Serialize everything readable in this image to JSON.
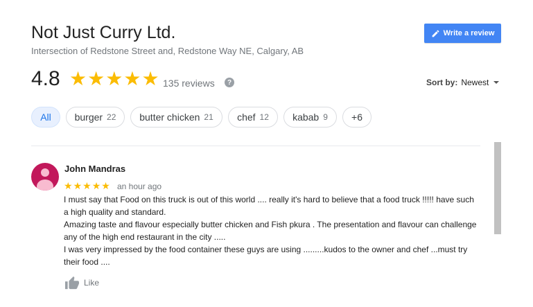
{
  "business": {
    "name": "Not Just Curry Ltd.",
    "address": "Intersection of Redstone Street and, Redstone Way NE, Calgary, AB"
  },
  "write_review": {
    "label": "Write a review",
    "icon": "pencil-icon"
  },
  "summary": {
    "rating": "4.8",
    "stars": 5,
    "reviews_label": "135 reviews"
  },
  "sort": {
    "label": "Sort by:",
    "value": "Newest"
  },
  "filters": [
    {
      "label": "All",
      "count": "",
      "active": true
    },
    {
      "label": "burger",
      "count": "22",
      "active": false
    },
    {
      "label": "butter chicken",
      "count": "21",
      "active": false
    },
    {
      "label": "chef",
      "count": "12",
      "active": false
    },
    {
      "label": "kabab",
      "count": "9",
      "active": false
    },
    {
      "label": "+6",
      "count": "",
      "active": false
    }
  ],
  "review": {
    "author": "John Mandras",
    "stars": 5,
    "time": "an hour ago",
    "lines": [
      "I must say that Food on this truck is out of this world .... really it's hard to believe that a food truck !!!!! have such a high quality and standard.",
      "Amazing taste and flavour especially butter chicken and Fish pkura . The presentation and flavour can challenge any of the high end restaurant in the city .....",
      "I was very impressed by the food container these guys are using .........kudos to the owner and chef ...must try their food ...."
    ],
    "like_label": "Like"
  },
  "colors": {
    "accent": "#4285f4",
    "star": "#fbbc04",
    "avatar": "#c2185b",
    "chip_active_bg": "#e8f0fe",
    "chip_active_text": "#1a73e8"
  }
}
